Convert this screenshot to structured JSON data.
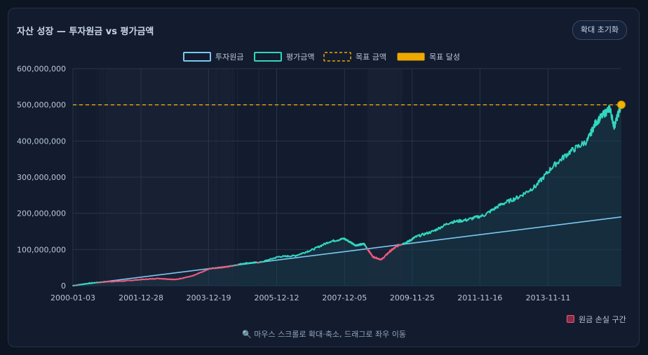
{
  "title": "자산 성장 — 투자원금 vs 평가금액",
  "reset_button": "확대 초기화",
  "hint": "🔍 마우스 스크롤로 확대·축소, 드래그로 좌우 이동",
  "loss_legend": "원금 손실 구간",
  "colors": {
    "principal": "#7cc7f2",
    "value": "#33d6be",
    "loss": "#f05a7e",
    "goal": "#f0a800",
    "grid": "#26354d",
    "axis_text": "#b9c6dc"
  },
  "chart_data": {
    "type": "line",
    "title": "자산 성장 — 투자원금 vs 평가금액",
    "legend": {
      "position": "top",
      "entries": [
        "투자원금",
        "평가금액",
        "목표 금액",
        "목표 달성"
      ]
    },
    "x_tick_labels": [
      "2000-01-03",
      "2001-12-28",
      "2003-12-19",
      "2005-12-12",
      "2007-12-05",
      "2009-11-25",
      "2011-11-16",
      "2013-11-11"
    ],
    "x_range": [
      "2000-01-03",
      "2015-12-31"
    ],
    "y_tick_labels": [
      "0",
      "100,000,000",
      "200,000,000",
      "300,000,000",
      "400,000,000",
      "500,000,000",
      "600,000,000"
    ],
    "ylim": [
      0,
      600000000
    ],
    "grid": true,
    "goal": {
      "name": "목표 금액",
      "value": 500000000
    },
    "goal_reached": {
      "name": "목표 달성",
      "date": "2015-12-31",
      "value": 500000000
    },
    "loss_band_legend": "원금 손실 구간",
    "series": [
      {
        "name": "투자원금",
        "x": [
          "2000-01-03",
          "2015-12-31"
        ],
        "values": [
          0,
          190000000
        ]
      },
      {
        "name": "평가금액",
        "x": [
          "2000-01-03",
          "2000-07-01",
          "2001-01-01",
          "2001-07-01",
          "2002-01-01",
          "2002-07-01",
          "2003-01-01",
          "2003-07-01",
          "2004-01-01",
          "2004-07-01",
          "2005-01-01",
          "2005-07-01",
          "2006-01-01",
          "2006-07-01",
          "2007-01-01",
          "2007-07-01",
          "2007-12-01",
          "2008-04-01",
          "2008-07-01",
          "2008-10-01",
          "2009-01-01",
          "2009-04-01",
          "2009-07-01",
          "2009-10-01",
          "2010-01-01",
          "2010-07-01",
          "2011-01-01",
          "2011-07-01",
          "2012-01-01",
          "2012-07-01",
          "2013-01-01",
          "2013-07-01",
          "2014-01-01",
          "2014-07-01",
          "2015-01-01",
          "2015-04-01",
          "2015-07-01",
          "2015-09-01",
          "2015-10-15",
          "2015-12-31"
        ],
        "values": [
          0,
          7000000,
          11000000,
          13000000,
          17000000,
          20000000,
          17000000,
          27000000,
          47000000,
          52000000,
          62000000,
          65000000,
          80000000,
          83000000,
          100000000,
          122000000,
          130000000,
          112000000,
          115000000,
          80000000,
          72000000,
          95000000,
          112000000,
          120000000,
          135000000,
          150000000,
          175000000,
          182000000,
          195000000,
          225000000,
          245000000,
          275000000,
          330000000,
          370000000,
          400000000,
          450000000,
          475000000,
          490000000,
          440000000,
          500000000
        ]
      }
    ]
  }
}
